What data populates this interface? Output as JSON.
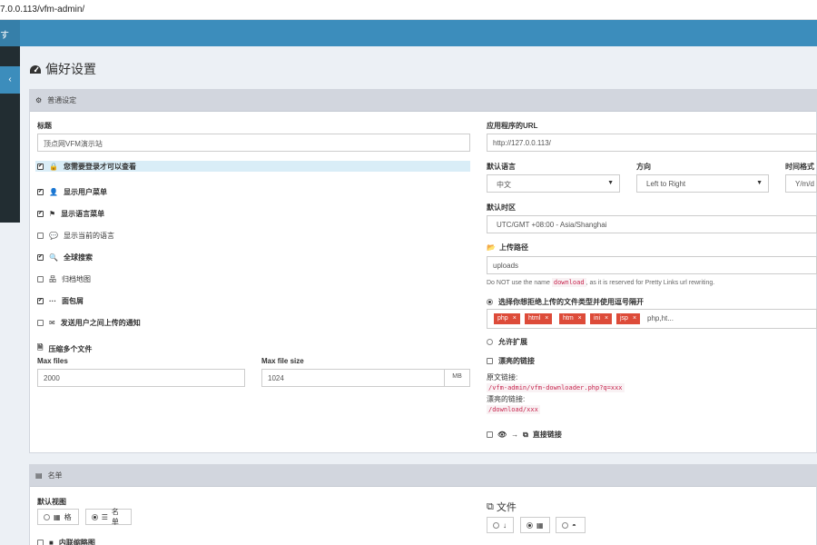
{
  "browser": {
    "url": "7.0.0.113/vfm-admin/"
  },
  "header": {
    "brand_fragment": "す",
    "toggle_glyph": "‹"
  },
  "page": {
    "title": "偏好设置",
    "title_icon": "dashboard-icon"
  },
  "general": {
    "panel_title": "普通设定",
    "title_label": "标题",
    "title_value": "顶点网VFM演示站",
    "app_url_label": "应用程序的URL",
    "app_url_value": "http://127.0.0.113/",
    "checkboxes": [
      {
        "label": "您需要登录才可以查看",
        "checked": true,
        "icon": "lock-icon"
      },
      {
        "label": "显示用户菜单",
        "checked": true,
        "icon": "user-icon"
      },
      {
        "label": "显示语言菜单",
        "checked": true,
        "icon": "flag-icon"
      },
      {
        "label": "显示当前的语言",
        "checked": false,
        "icon": "comment-icon"
      },
      {
        "label": "全球搜索",
        "checked": true,
        "icon": "search-icon"
      },
      {
        "label": "归档地图",
        "checked": false,
        "icon": "sitemap-icon"
      },
      {
        "label": "面包屑",
        "checked": true,
        "icon": "ellipsis-icon"
      },
      {
        "label": "发送用户之间上传的通知",
        "checked": false,
        "icon": "envelope-icon"
      }
    ],
    "zip_label": "压缩多个文件",
    "max_files_label": "Max files",
    "max_files_value": "2000",
    "max_file_size_label": "Max file size",
    "max_file_size_value": "1024",
    "max_file_size_unit": "MB",
    "default_lang_label": "默认语言",
    "default_lang_value": "中文",
    "direction_label": "方向",
    "direction_value": "Left to Right",
    "time_format_label": "时间格式",
    "time_format_value": "Y/m/d",
    "timezone_label": "默认时区",
    "timezone_value": "UTC/GMT +08:00 - Asia/Shanghai",
    "upload_path_label": "上传路径",
    "upload_path_value": "uploads",
    "note_prefix": "Do NOT use the name",
    "note_code": "download",
    "note_suffix": ", as it is reserved for Pretty Links url rewriting.",
    "reject_label": "选择你想拒绝上传的文件类型并使用逗号隔开",
    "reject_tags": [
      "php",
      "html",
      "htm",
      "ini",
      "jsp"
    ],
    "reject_input": "php,ht...",
    "allow_ext_label": "允许扩展",
    "pretty_links_label": "漂亮的链接",
    "original_link_label": "原文链接:",
    "original_link_code": "/vfm-admin/vfm-downloader.php?q=xxx",
    "pretty_link_label": "漂亮的链接:",
    "pretty_link_code": "/download/xxx",
    "direct_link_label": "直接链接"
  },
  "list": {
    "panel_title": "名单",
    "default_view_label": "默认视图",
    "view_grid": "格",
    "view_list": "名单",
    "files_label": "文件",
    "inline_thumbs_label": "内联缩略图"
  },
  "colors": {
    "topbar": "#3c8dbc",
    "sidebar": "#222d32",
    "tag": "#dd4b39"
  }
}
